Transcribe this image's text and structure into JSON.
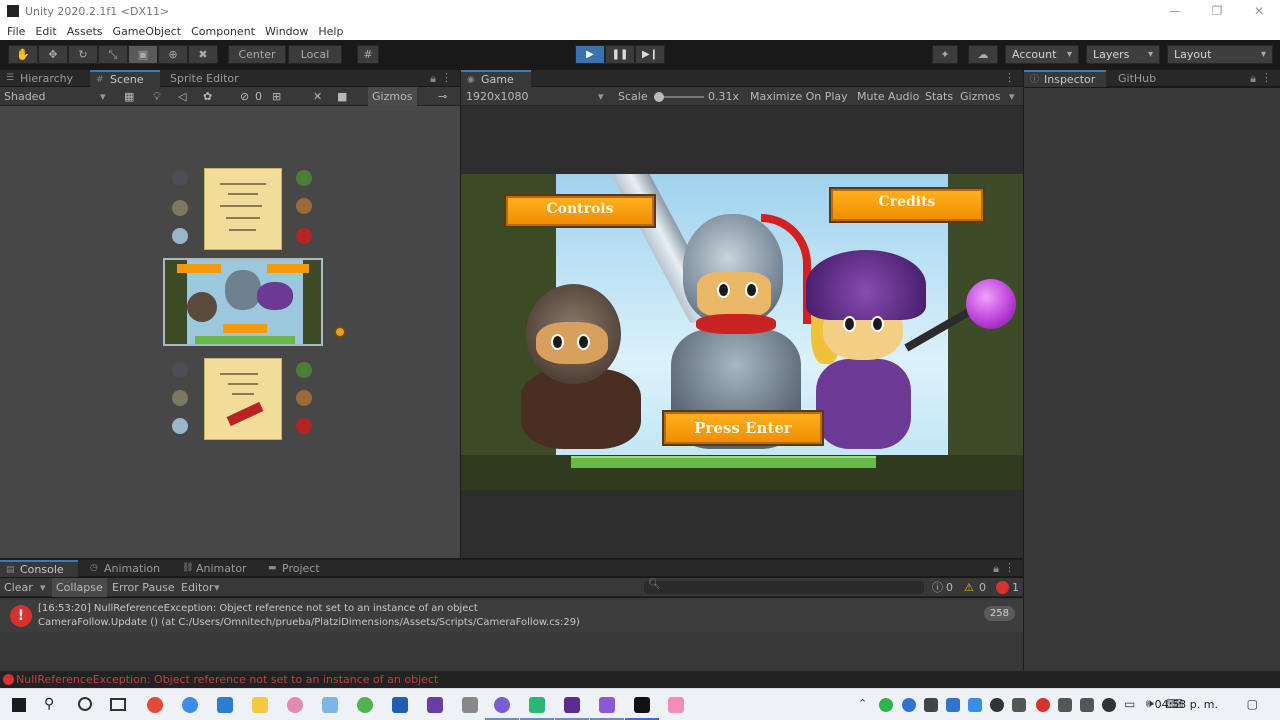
{
  "window": {
    "title": "Unity 2020.2.1f1 <DX11>",
    "controls": [
      "—",
      "❐",
      "✕"
    ]
  },
  "menu": [
    "File",
    "Edit",
    "Assets",
    "GameObject",
    "Component",
    "Window",
    "Help"
  ],
  "toolbar": {
    "pivot": "Center",
    "space": "Local",
    "account": "Account",
    "layers": "Layers",
    "layout": "Layout",
    "play_icon": "▶",
    "pause_icon": "❚❚",
    "step_icon": "▶❙"
  },
  "left_tabs": [
    "Hierarchy",
    "Scene",
    "Sprite Editor"
  ],
  "scene_bar": {
    "shading": "Shaded",
    "layer_count": "0",
    "gizmos": "Gizmos"
  },
  "game": {
    "tab": "Game",
    "resolution": "1920x1080",
    "scale_label": "Scale",
    "scale_value": "0.31x",
    "maximize": "Maximize On Play",
    "mute": "Mute Audio",
    "stats": "Stats",
    "gizmos": "Gizmos",
    "buttons": {
      "controls": "Controls",
      "credits": "Credits",
      "press_enter": "Press Enter"
    }
  },
  "right_tabs": [
    "Inspector",
    "GitHub"
  ],
  "bottom_tabs": [
    "Console",
    "Animation",
    "Animator",
    "Project"
  ],
  "console": {
    "clear": "Clear",
    "collapse": "Collapse",
    "error_pause": "Error Pause",
    "editor": "Editor",
    "log_count": "0",
    "warn_count": "0",
    "error_count": "1",
    "line1": "[16:53:20] NullReferenceException: Object reference not set to an instance of an object",
    "line2": "CameraFollow.Update () (at C:/Users/Omnitech/prueba/PlatziDimensions/Assets/Scripts/CameraFollow.cs:29)",
    "repeat_count": "258"
  },
  "status_bar": {
    "message": "NullReferenceException: Object reference not set to an instance of an object"
  },
  "taskbar": {
    "time": "04:53 p. m."
  },
  "colors": {
    "accent": "#3a79bb",
    "error": "#d8322f",
    "button_orange": "#f59a0a"
  }
}
